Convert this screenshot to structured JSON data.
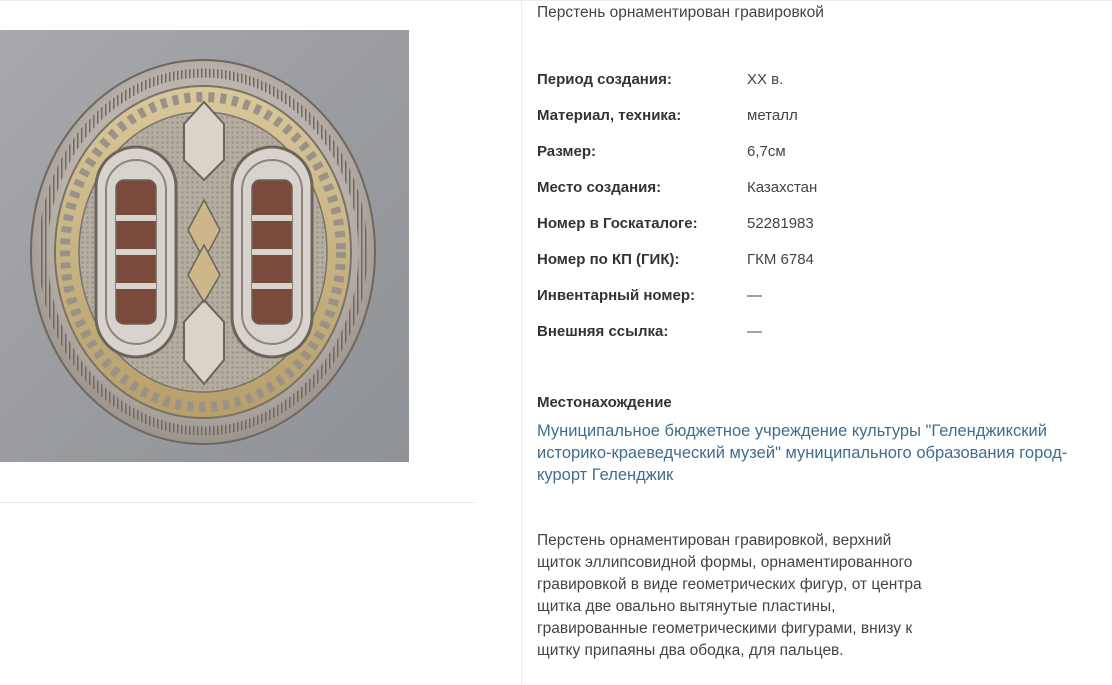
{
  "item": {
    "subtitle": "Перстень орнаментирован гравировкой",
    "image_alt": "Перстень"
  },
  "properties": [
    {
      "label": "Период создания:",
      "value": "XX в."
    },
    {
      "label": "Материал, техника:",
      "value": "металл"
    },
    {
      "label": "Размер:",
      "value": "6,7см"
    },
    {
      "label": "Место создания:",
      "value": "Казахстан"
    },
    {
      "label": "Номер в Госкаталоге:",
      "value": "52281983"
    },
    {
      "label": "Номер по КП (ГИК):",
      "value": "ГКМ 6784"
    },
    {
      "label": "Инвентарный номер:",
      "value": "—"
    },
    {
      "label": "Внешняя ссылка:",
      "value": "—"
    }
  ],
  "location": {
    "heading": "Местонахождение",
    "link_text": "Муниципальное бюджетное учреждение культуры \"Геленджикский историко-краеведческий музей\" муниципального образования город-курорт Геленджик"
  },
  "description": "Перстень орнаментирован гравировкой, верхний щиток эллипсовидной формы, орнаментированного гравировкой в виде геометрических фигур, от центра щитка две овально вытянутые пластины, гравированные геометрическими фигурами, внизу к щитку припаяны два ободка, для пальцев.",
  "colors": {
    "link": "#3d6e8f",
    "label": "#333333",
    "text": "#444444",
    "divider": "#ececec",
    "photo_background": "#9b9da1",
    "silver": "#c9c3bb",
    "gold": "#cbb98a"
  }
}
